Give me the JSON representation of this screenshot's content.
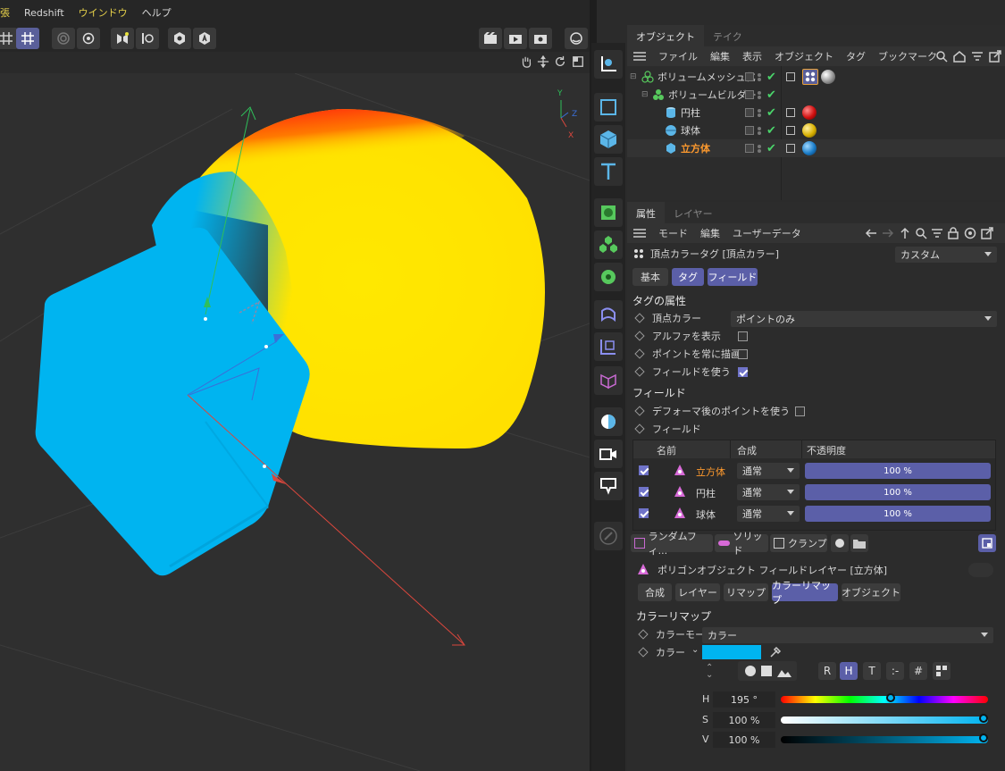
{
  "menubar": {
    "items": [
      "張",
      "Redshift",
      "ウインドウ",
      "ヘルプ"
    ]
  },
  "objects": {
    "tabs": [
      "オブジェクト",
      "テイク"
    ],
    "menu": [
      "ファイル",
      "編集",
      "表示",
      "オブジェクト",
      "タグ",
      "ブックマーク"
    ],
    "tree": [
      {
        "label": "ボリュームメッシュ化"
      },
      {
        "label": "ボリュームビルダー"
      },
      {
        "label": "円柱"
      },
      {
        "label": "球体"
      },
      {
        "label": "立方体"
      }
    ]
  },
  "attributes": {
    "tabs": [
      "属性",
      "レイヤー"
    ],
    "menu": [
      "モード",
      "編集",
      "ユーザーデータ"
    ],
    "tag_title": "頂点カラータグ [頂点カラー]",
    "preset": "カスタム",
    "subtabs": [
      "基本",
      "タグ",
      "フィールド"
    ],
    "section_tag": "タグの属性",
    "vertex_color_label": "頂点カラー",
    "vertex_color_value": "ポイントのみ",
    "show_alpha": "アルファを表示",
    "always_draw": "ポイントを常に描画",
    "use_fields": "フィールドを使う",
    "section_field": "フィールド",
    "use_deformed": "デフォーマ後のポイントを使う",
    "field_label": "フィールド",
    "table_headers": [
      "名前",
      "合成",
      "不透明度"
    ],
    "field_rows": [
      {
        "name": "立方体",
        "blend": "通常",
        "opacity": "100 %"
      },
      {
        "name": "円柱",
        "blend": "通常",
        "opacity": "100 %"
      },
      {
        "name": "球体",
        "blend": "通常",
        "opacity": "100 %"
      }
    ],
    "field_buttons": [
      "ランダムフィ...",
      "ソリッド",
      "クランプ"
    ],
    "layer_title": "ポリゴンオブジェクト フィールドレイヤー [立方体]",
    "layer_tabs": [
      "合成",
      "レイヤー",
      "リマップ",
      "カラーリマップ",
      "オブジェクト"
    ],
    "section_colorremap": "カラーリマップ",
    "color_mode_label": "カラーモード",
    "color_mode_value": "カラー",
    "color_label": "カラー",
    "color_hex": "#00b4f0",
    "mode_buttons": [
      "R",
      "H",
      "T",
      ":-",
      "#"
    ],
    "hsv": [
      {
        "label": "H",
        "value": "195 °"
      },
      {
        "label": "S",
        "value": "100 %"
      },
      {
        "label": "V",
        "value": "100 %"
      }
    ]
  }
}
